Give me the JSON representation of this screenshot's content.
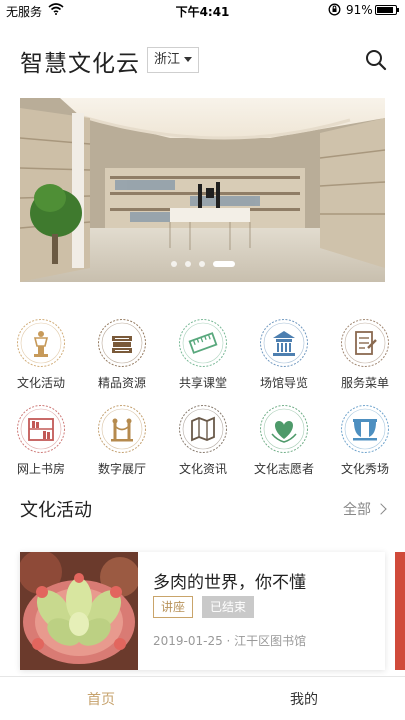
{
  "status_bar": {
    "carrier": "无服务",
    "time": "下午4:41",
    "battery_percent": "91%",
    "battery_level": 0.91
  },
  "header": {
    "title": "智慧文化云",
    "region": "浙江"
  },
  "banner": {
    "slide_count": 4,
    "active_slide": 4
  },
  "services": {
    "row1": [
      {
        "label": "文化活动",
        "icon": "lamp-icon",
        "color": "#c79a5a"
      },
      {
        "label": "精品资源",
        "icon": "books-icon",
        "color": "#7a5a3a"
      },
      {
        "label": "共享课堂",
        "icon": "ruler-icon",
        "color": "#59a87d"
      },
      {
        "label": "场馆导览",
        "icon": "temple-icon",
        "color": "#4d7fb0"
      },
      {
        "label": "服务菜单",
        "icon": "document-icon",
        "color": "#8a6a50"
      }
    ],
    "row2": [
      {
        "label": "网上书房",
        "icon": "bookshelf-icon",
        "color": "#c25a57"
      },
      {
        "label": "数字展厅",
        "icon": "exhibition-icon",
        "color": "#b58a4e"
      },
      {
        "label": "文化资讯",
        "icon": "map-icon",
        "color": "#6a5a4a"
      },
      {
        "label": "文化志愿者",
        "icon": "heart-hands-icon",
        "color": "#4e9a6a"
      },
      {
        "label": "文化秀场",
        "icon": "stage-icon",
        "color": "#4d8fc0"
      }
    ]
  },
  "section": {
    "title": "文化活动",
    "more": "全部"
  },
  "activity": {
    "title": "多肉的世界，你不懂",
    "type_tag": "讲座",
    "status_tag": "已结束",
    "meta": "2019-01-25 · 江干区图书馆"
  },
  "tabbar": {
    "home": "首页",
    "mine": "我的",
    "active_color": "#c7a36e"
  }
}
